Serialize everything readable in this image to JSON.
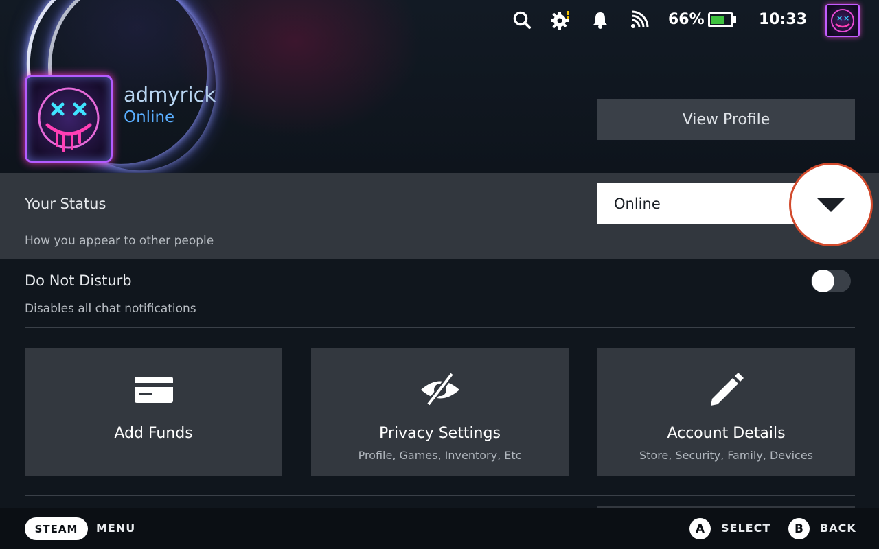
{
  "topbar": {
    "icons": [
      "search-icon",
      "settings-gear-icon",
      "notification-bell-icon",
      "wifi-signal-icon",
      "battery-icon"
    ],
    "battery": "66%",
    "battery_level": 0.66,
    "time": "10:33"
  },
  "profile": {
    "username": "admyrick",
    "status": "Online",
    "view_profile_label": "View Profile"
  },
  "status_setting": {
    "title": "Your Status",
    "subtitle": "How you appear to other people",
    "selected": "Online"
  },
  "dnd": {
    "title": "Do Not Disturb",
    "subtitle": "Disables all chat notifications",
    "enabled": false
  },
  "tiles": [
    {
      "title": "Add Funds",
      "subtitle": "",
      "icon": "credit-card-icon"
    },
    {
      "title": "Privacy Settings",
      "subtitle": "Profile, Games, Inventory, Etc",
      "icon": "eye-slash-icon"
    },
    {
      "title": "Account Details",
      "subtitle": "Store, Security, Family, Devices",
      "icon": "pencil-icon"
    }
  ],
  "footer": {
    "steam_label": "STEAM",
    "menu_label": "MENU",
    "a_glyph": "A",
    "select_label": "SELECT",
    "b_glyph": "B",
    "back_label": "BACK"
  },
  "colors": {
    "accent_blue": "#5aaeff",
    "username_blue": "#b9d6f2",
    "highlight_ring": "#d24a2c",
    "panel": "#33383f",
    "battery_green": "#3fc23f"
  }
}
